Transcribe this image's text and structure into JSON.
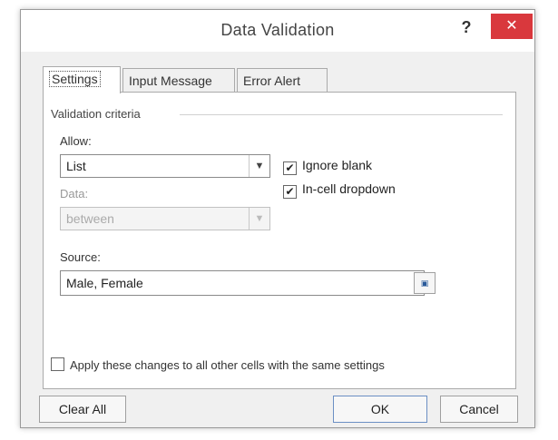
{
  "dialog": {
    "title": "Data Validation",
    "help_glyph": "?",
    "close_glyph": "✕"
  },
  "tabs": [
    {
      "label": "Settings",
      "active": true
    },
    {
      "label": "Input Message",
      "active": false
    },
    {
      "label": "Error Alert",
      "active": false
    }
  ],
  "settings": {
    "group_label": "Validation criteria",
    "allow_label": "Allow:",
    "allow_value": "List",
    "data_label": "Data:",
    "data_value": "between",
    "ignore_blank_label": "Ignore blank",
    "ignore_blank_checked": true,
    "incell_dropdown_label": "In-cell dropdown",
    "incell_dropdown_checked": true,
    "source_label": "Source:",
    "source_value": "Male, Female",
    "apply_all_label": "Apply these changes to all other cells with the same settings",
    "apply_all_checked": false
  },
  "buttons": {
    "clear_all": "Clear All",
    "ok": "OK",
    "cancel": "Cancel"
  },
  "icons": {
    "dropdown": "chevron-down-icon",
    "range_select": "collapse-dialog-icon",
    "check": "checkmark-icon"
  },
  "colors": {
    "close_button": "#d9383d",
    "dialog_bg": "#f0f0f0"
  }
}
